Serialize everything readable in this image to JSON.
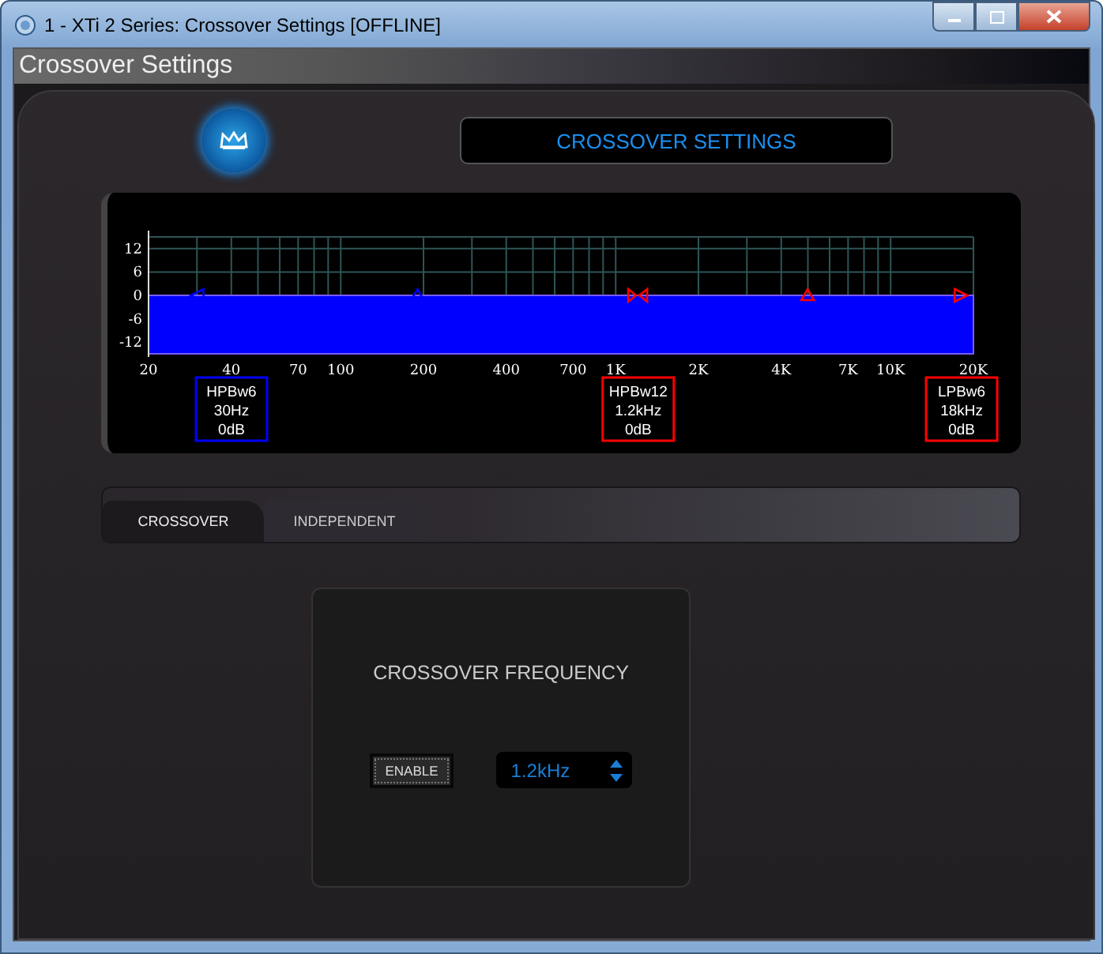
{
  "window": {
    "title": "1 - XTi 2 Series: Crossover Settings [OFFLINE]"
  },
  "header": {
    "title": "Crossover Settings"
  },
  "display": {
    "title": "CROSSOVER SETTINGS"
  },
  "response": {
    "y_axis_labels": [
      "12",
      "6",
      "0",
      "-6",
      "-12"
    ],
    "x_axis_labels": [
      "20",
      "40",
      "70",
      "100",
      "200",
      "400",
      "700",
      "1K",
      "2K",
      "4K",
      "7K",
      "10K",
      "20K"
    ],
    "markers": [
      {
        "kind": "left",
        "color": "#0000ff",
        "level": 0.059
      },
      {
        "kind": "up",
        "color": "#0000ff",
        "level": 0.326
      },
      {
        "kind": "both",
        "color": "#ff0000",
        "level": 0.593
      },
      {
        "kind": "up",
        "color": "#ff0000",
        "level": 0.799
      },
      {
        "kind": "right",
        "color": "#ff0000",
        "level": 0.985
      }
    ],
    "filters": [
      {
        "type": "HPBw6",
        "frequency": "30Hz",
        "gain": "0dB",
        "color": "#0000ff"
      },
      {
        "type": "HPBw12",
        "frequency": "1.2kHz",
        "gain": "0dB",
        "color": "#ff0000"
      },
      {
        "type": "LPBw6",
        "frequency": "18kHz",
        "gain": "0dB",
        "color": "#ff0000"
      }
    ]
  },
  "tabs": [
    {
      "label": "CROSSOVER",
      "selected": true
    },
    {
      "label": "INDEPENDENT",
      "selected": false
    }
  ],
  "crossover": {
    "title": "CROSSOVER FREQUENCY",
    "enable_button": "ENABLE",
    "frequency": "1.2kHz"
  }
}
